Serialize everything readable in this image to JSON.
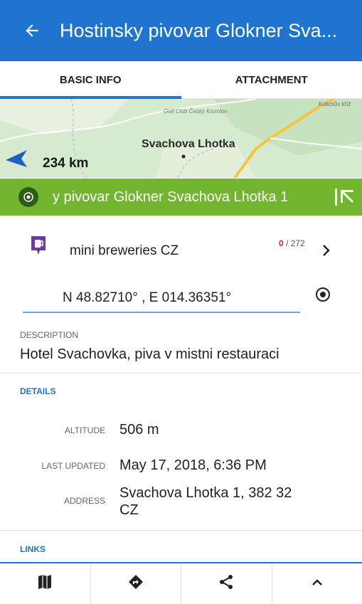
{
  "appbar": {
    "title": "Hostinsky pivovar Glokner Sva..."
  },
  "tabs": [
    {
      "label": "BASIC INFO"
    },
    {
      "label": "ATTACHMENT"
    }
  ],
  "map": {
    "place_label": "Svachova Lhotka",
    "golf_label": "Golf Club Český Krumlov",
    "corner_label": "Kulichův kříž",
    "distance": "234 km"
  },
  "namebar": {
    "name": "y pivovar Glokner Svachova Lhotka 1"
  },
  "category": {
    "label": "mini breweries CZ",
    "count_red": "0",
    "count_total": " / 272"
  },
  "coordinates": {
    "value": "N 48.82710° , E 014.36351°"
  },
  "description": {
    "label": "DESCRIPTION",
    "text": "Hotel Svachovka, piva v mistni restauraci"
  },
  "details": {
    "title": "DETAILS",
    "altitude_key": "ALTITUDE",
    "altitude_val": "506 m",
    "updated_key": "LAST UPDATED",
    "updated_val": "May 17, 2018, 6:36 PM",
    "address_key": "ADDRESS",
    "address_line1": "Svachova Lhotka 1, 382 32",
    "address_line2": "CZ"
  },
  "links": {
    "title": "LINKS"
  },
  "colors": {
    "primary": "#1f74d0",
    "name_bar": "#72b52e",
    "category_icon": "#6a3c9c"
  }
}
